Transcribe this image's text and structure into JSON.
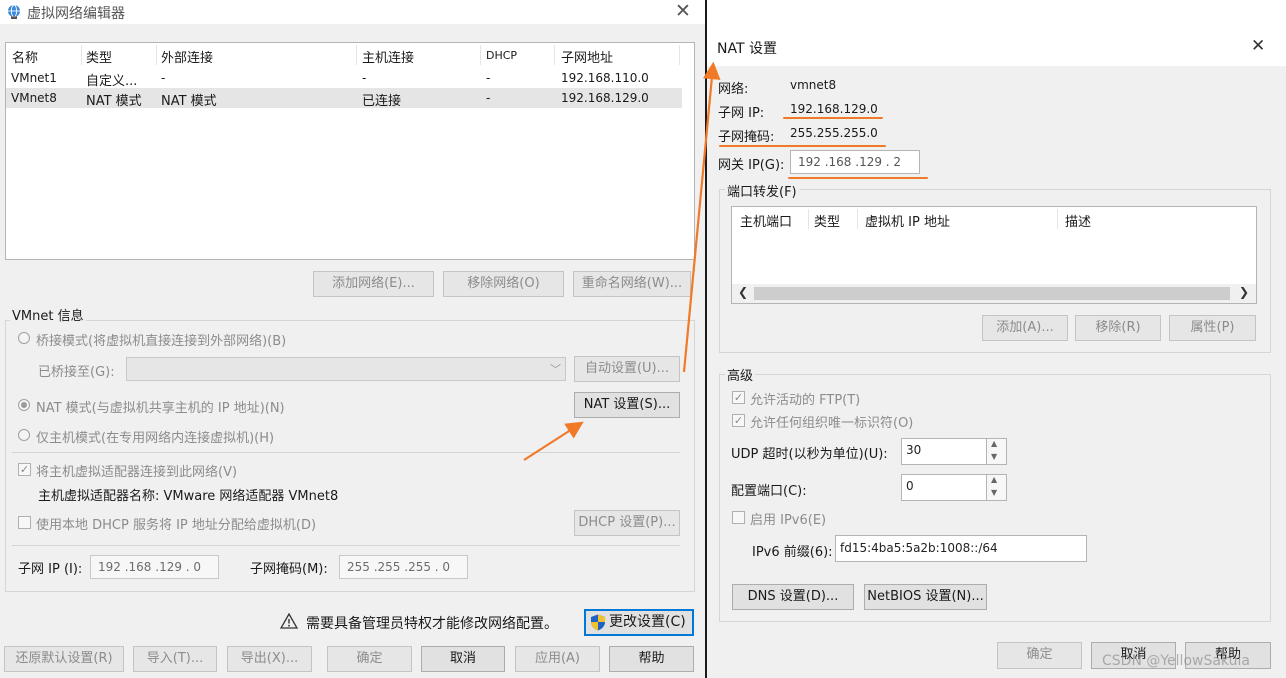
{
  "left": {
    "title": "虚拟网络编辑器",
    "table": {
      "headers": [
        "名称",
        "类型",
        "外部连接",
        "主机连接",
        "DHCP",
        "子网地址"
      ],
      "rows": [
        [
          "VMnet1",
          "自定义...",
          "-",
          "-",
          "-",
          "192.168.110.0"
        ],
        [
          "VMnet8",
          "NAT 模式",
          "NAT 模式",
          "已连接",
          "-",
          "192.168.129.0"
        ]
      ]
    },
    "buttons": {
      "add_network": "添加网络(E)...",
      "remove_network": "移除网络(O)",
      "rename_network": "重命名网络(W)...",
      "auto_settings": "自动设置(U)...",
      "nat_settings": "NAT 设置(S)...",
      "dhcp_settings": "DHCP 设置(P)...",
      "change_settings": "更改设置(C)",
      "restore_defaults": "还原默认设置(R)",
      "import": "导入(T)...",
      "export": "导出(X)...",
      "ok": "确定",
      "cancel": "取消",
      "apply": "应用(A)",
      "help": "帮助"
    },
    "vmnet_info": {
      "group_label": "VMnet 信息",
      "bridged": "桥接模式(将虚拟机直接连接到外部网络)(B)",
      "bridged_to_label": "已桥接至(G):",
      "nat": "NAT 模式(与虚拟机共享主机的 IP 地址)(N)",
      "host_only": "仅主机模式(在专用网络内连接虚拟机)(H)",
      "connect_adapter": "将主机虚拟适配器连接到此网络(V)",
      "adapter_name": "主机虚拟适配器名称: VMware 网络适配器 VMnet8",
      "use_dhcp": "使用本地 DHCP 服务将 IP 地址分配给虚拟机(D)",
      "subnet_ip_label": "子网 IP (I):",
      "subnet_ip": "192 .168 .129 .  0",
      "subnet_mask_label": "子网掩码(M):",
      "subnet_mask": "255 .255 .255 .  0"
    },
    "admin_notice": "需要具备管理员特权才能修改网络配置。"
  },
  "right": {
    "title": "NAT 设置",
    "network_label": "网络:",
    "network_value": "vmnet8",
    "subnet_ip_label": "子网 IP:",
    "subnet_ip_value": "192.168.129.0",
    "subnet_mask_label": "子网掩码:",
    "subnet_mask_value": "255.255.255.0",
    "gateway_label": "网关 IP(G):",
    "gateway_value": "192 .168 .129 .  2",
    "port_forwarding": {
      "group_label": "端口转发(F)",
      "headers": [
        "主机端口",
        "类型",
        "虚拟机 IP 地址",
        "描述"
      ],
      "add": "添加(A)...",
      "remove": "移除(R)",
      "properties": "属性(P)"
    },
    "advanced": {
      "group_label": "高级",
      "allow_ftp": "允许活动的 FTP(T)",
      "allow_uuid": "允许任何组织唯一标识符(O)",
      "udp_timeout_label": "UDP 超时(以秒为单位)(U):",
      "udp_timeout_value": "30",
      "config_port_label": "配置端口(C):",
      "config_port_value": "0",
      "enable_ipv6": "启用 IPv6(E)",
      "ipv6_prefix_label": "IPv6 前缀(6):",
      "ipv6_prefix_value": "fd15:4ba5:5a2b:1008::/64",
      "dns_settings": "DNS 设置(D)...",
      "netbios_settings": "NetBIOS 设置(N)..."
    },
    "buttons": {
      "ok": "确定",
      "cancel": "取消",
      "help": "帮助"
    }
  },
  "watermark": "CSDN @YellowSakula",
  "colors": {
    "annotation": "#f07a28",
    "selection": "#e5e5e5",
    "window_bg": "#f0f0f0"
  }
}
